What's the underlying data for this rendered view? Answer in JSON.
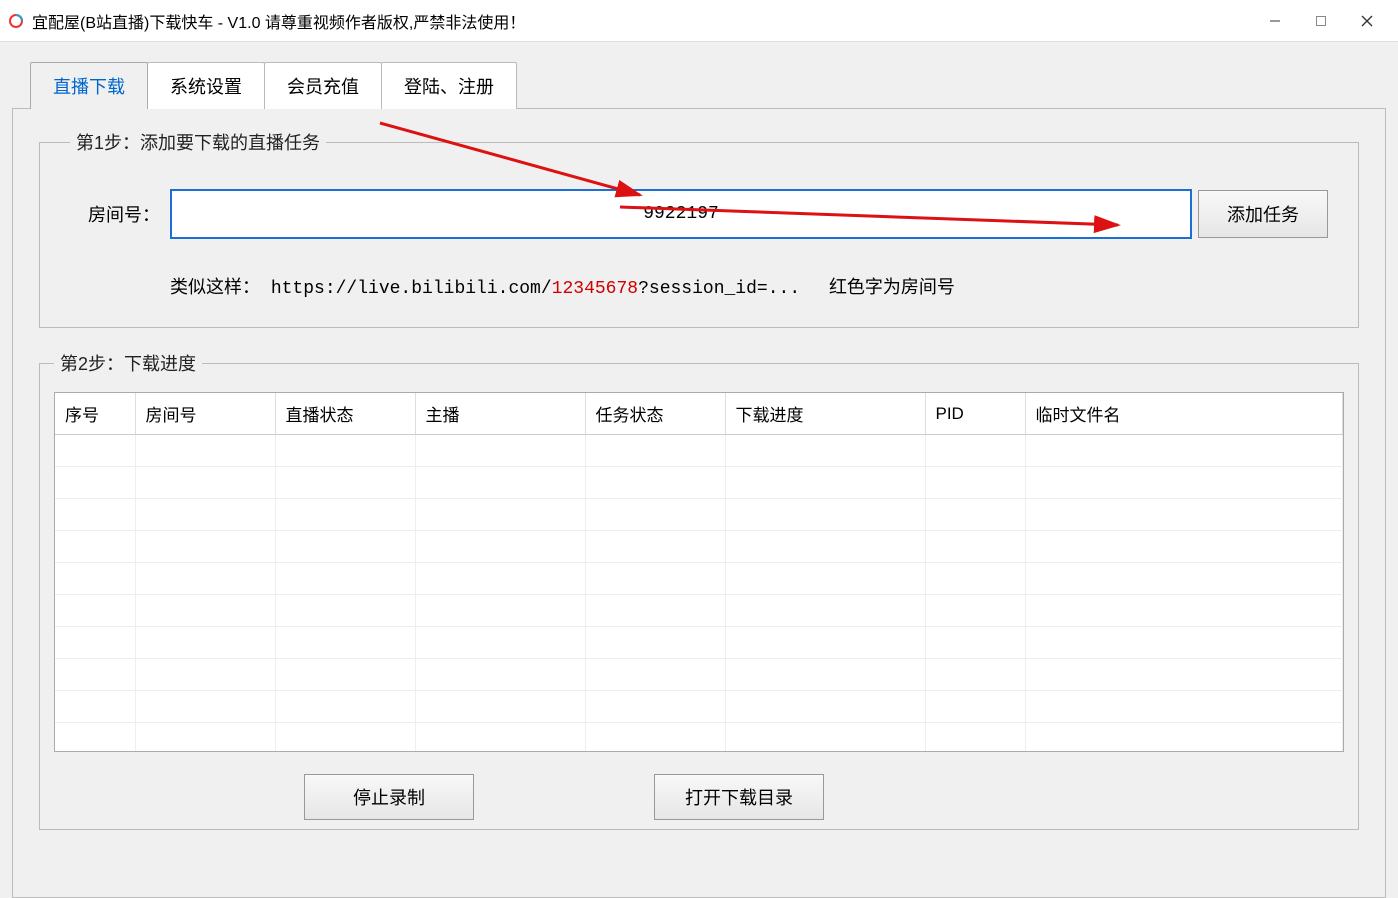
{
  "window": {
    "title": "宜配屋(B站直播)下载快车 - V1.0 请尊重视频作者版权,严禁非法使用！"
  },
  "tabs": {
    "t0": "直播下载",
    "t1": "系统设置",
    "t2": "会员充值",
    "t3": "登陆、注册"
  },
  "step1": {
    "legend": "第1步：添加要下载的直播任务",
    "roomLabel": "房间号：",
    "roomValue": "9922197",
    "addButton": "添加任务",
    "hintPrefix": "类似这样：",
    "hintUrlPrefix": "https://live.bilibili.com/",
    "hintRoomExample": "12345678",
    "hintUrlSuffix": "?session_id=...",
    "hintNote": "红色字为房间号"
  },
  "step2": {
    "legend": "第2步：下载进度",
    "columns": {
      "c0": "序号",
      "c1": "房间号",
      "c2": "直播状态",
      "c3": "主播",
      "c4": "任务状态",
      "c5": "下载进度",
      "c6": "PID",
      "c7": "临时文件名"
    },
    "stopButton": "停止录制",
    "openDirButton": "打开下载目录"
  }
}
